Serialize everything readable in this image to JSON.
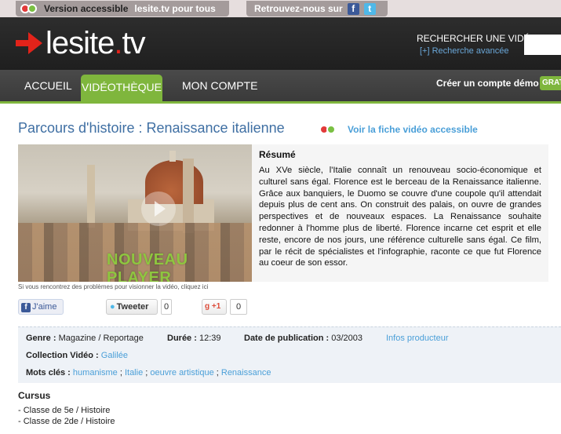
{
  "access_bar": {
    "version_label": "Version accessible",
    "version_link": "lesite.tv pour tous",
    "follow_label": "Retrouvez-nous sur",
    "facebook_icon": "facebook-icon",
    "twitter_icon": "twitter-icon"
  },
  "header": {
    "logo_text_main": "lesite",
    "logo_text_dot": ".",
    "logo_text_tld": "tv",
    "search_label": "RECHERCHER UNE VIDÉO",
    "search_advanced": "[+] Recherche avancée",
    "search_value": ""
  },
  "nav": {
    "items": [
      {
        "label": "ACCUEIL",
        "active": false
      },
      {
        "label": "VIDÉOTHÈQUE",
        "active": true
      },
      {
        "label": "MON COMPTE",
        "active": false
      }
    ],
    "create_account": "Créer un compte démo",
    "grat_label": "GRAT"
  },
  "page": {
    "title": "Parcours d'histoire : Renaissance italienne",
    "accessible_link": "Voir la fiche vidéo accessible"
  },
  "video": {
    "player_label": "NOUVEAU PLAYER",
    "problem_note": "Si vous rencontrez des problèmes pour visionner la vidéo, cliquez ici"
  },
  "summary": {
    "heading": "Résumé",
    "text": "Au XVe siècle, l'Italie connaît un renouveau socio-économique et culturel sans égal. Florence est le berceau de la Renaissance italienne. Grâce aux banquiers, le Duomo se couvre d'une coupole qu'il attendait depuis plus de cent ans. On construit des palais, on ouvre de grandes perspectives et de nouveaux espaces. La Renaissance souhaite redonner à l'homme plus de liberté. Florence incarne cet esprit et elle reste, encore de nos jours, une référence culturelle sans égal. Ce film, par le récit de spécialistes et l'infographie, raconte ce que fut Florence au coeur de son essor."
  },
  "share": {
    "fb_label": "J'aime",
    "tw_label": "Tweeter",
    "tw_count": "0",
    "gp_label": "+1",
    "gp_count": "0"
  },
  "info": {
    "genre_label": "Genre :",
    "genre_value": "Magazine / Reportage",
    "duree_label": "Durée :",
    "duree_value": "12:39",
    "pub_label": "Date de publication :",
    "pub_value": "03/2003",
    "producer_link": "Infos producteur",
    "collection_label": "Collection Vidéo :",
    "collection_value": "Galilée",
    "keywords_label": "Mots clés :",
    "keywords": [
      "humanisme",
      "Italie",
      "oeuvre artistique",
      "Renaissance"
    ]
  },
  "cursus": {
    "heading": "Cursus",
    "items": [
      "- Classe de 5e / Histoire",
      "- Classe de 2de / Histoire"
    ]
  }
}
